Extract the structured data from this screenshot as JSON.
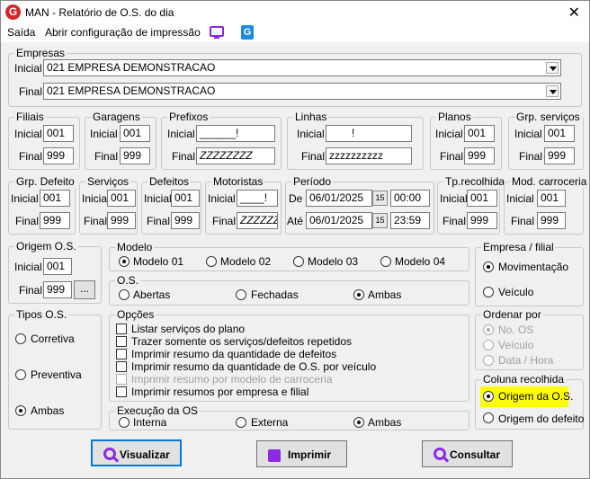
{
  "window": {
    "title": "MAN - Relatório de O.S. do dia",
    "app_icon": "G",
    "close": "✕"
  },
  "menu": {
    "saida": "Saída",
    "abrir": "Abrir configuração de impressão"
  },
  "empresas": {
    "legend": "Empresas",
    "inicial_label": "Inicial",
    "final_label": "Final",
    "inicial": "021 EMPRESA DEMONSTRACAO",
    "final": "021 EMPRESA DEMONSTRACAO"
  },
  "filiais": {
    "legend": "Filiais",
    "inicial_label": "Inicial",
    "final_label": "Final",
    "inicial": "001",
    "final": "999"
  },
  "garagens": {
    "legend": "Garagens",
    "inicial_label": "Inicial",
    "final_label": "Final",
    "inicial": "001",
    "final": "999"
  },
  "prefixos": {
    "legend": "Prefixos",
    "inicial_label": "Inicial",
    "final_label": "Final",
    "inicial": "______!",
    "final": "ZZZZZZZZ"
  },
  "linhas": {
    "legend": "Linhas",
    "inicial_label": "Inicial",
    "final_label": "Final",
    "inicial": "!",
    "final": "zzzzzzzzzz"
  },
  "planos": {
    "legend": "Planos",
    "inicial_label": "Inicial",
    "final_label": "Final",
    "inicial": "001",
    "final": "999"
  },
  "grp_servicos": {
    "legend": "Grp. serviços",
    "inicial_label": "Inicial",
    "final_label": "Final",
    "inicial": "001",
    "final": "999"
  },
  "grp_defeito": {
    "legend": "Grp. Defeito",
    "inicial_label": "Inicial",
    "final_label": "Final",
    "inicial": "001",
    "final": "999"
  },
  "servicos": {
    "legend": "Serviços",
    "inicial_label": "Inicial",
    "final_label": "Final",
    "inicial": "001",
    "final": "999"
  },
  "defeitos": {
    "legend": "Defeitos",
    "inicial_label": "Inicial",
    "final_label": "Final",
    "inicial": "001",
    "final": "999"
  },
  "motoristas": {
    "legend": "Motoristas",
    "inicial_label": "Inicial",
    "final_label": "Final",
    "inicial": "____!",
    "final": "ZZZZZZ"
  },
  "periodo": {
    "legend": "Período",
    "de_label": "De",
    "ate_label": "Até",
    "de_date": "06/01/2025",
    "de_time": "00:00",
    "ate_date": "06/01/2025",
    "ate_time": "23:59",
    "cal": "15"
  },
  "tp_recolhida": {
    "legend": "Tp.recolhida",
    "inicial_label": "Inicial",
    "final_label": "Final",
    "inicial": "001",
    "final": "999"
  },
  "mod_carroceria": {
    "legend": "Mod. carroceria",
    "inicial_label": "Inicial",
    "final_label": "Final",
    "inicial": "001",
    "final": "999"
  },
  "origem_os": {
    "legend": "Origem O.S.",
    "inicial_label": "Inicial",
    "final_label": "Final",
    "inicial": "001",
    "final": "999",
    "btn": "..."
  },
  "modelo": {
    "legend": "Modelo",
    "options": [
      "Modelo 01",
      "Modelo 02",
      "Modelo 03",
      "Modelo 04"
    ],
    "selected": 0
  },
  "os": {
    "legend": "O.S.",
    "options": [
      "Abertas",
      "Fechadas",
      "Ambas"
    ],
    "selected": 2
  },
  "empresa_filial": {
    "legend": "Empresa / filial",
    "options": [
      "Movimentação",
      "Veículo"
    ],
    "selected": 0
  },
  "tipos_os": {
    "legend": "Tipos O.S.",
    "options": [
      "Corretiva",
      "Preventiva",
      "Ambas"
    ],
    "selected": 2
  },
  "opcoes": {
    "legend": "Opções",
    "items": [
      {
        "label": "Listar serviços do plano",
        "enabled": true
      },
      {
        "label": "Trazer somente os serviços/defeitos repetidos",
        "enabled": true
      },
      {
        "label": "Imprimir resumo da quantidade de defeitos",
        "enabled": true
      },
      {
        "label": "Imprimir resumo da quantidade de O.S. por veículo",
        "enabled": true
      },
      {
        "label": "Imprimir resumo por modelo de carroceria",
        "enabled": false
      },
      {
        "label": "Imprimir resumos por empresa e filial",
        "enabled": true
      }
    ]
  },
  "ordenar": {
    "legend": "Ordenar por",
    "options": [
      "No. OS",
      "Veículo",
      "Data / Hora"
    ],
    "selected": 0
  },
  "execucao": {
    "legend": "Execução da OS",
    "options": [
      "Interna",
      "Externa",
      "Ambas"
    ],
    "selected": 2
  },
  "coluna": {
    "legend": "Coluna recolhida",
    "options": [
      "Origem da O.S.",
      "Origem do defeito"
    ],
    "selected": 0,
    "highlight_color": "#ffff00"
  },
  "buttons": {
    "visualizar": "Visualizar",
    "imprimir": "Imprimir",
    "consultar": "Consultar"
  },
  "colors": {
    "accent": "#8a2be2",
    "focus": "#0078d7",
    "brand": "#d4252a"
  }
}
